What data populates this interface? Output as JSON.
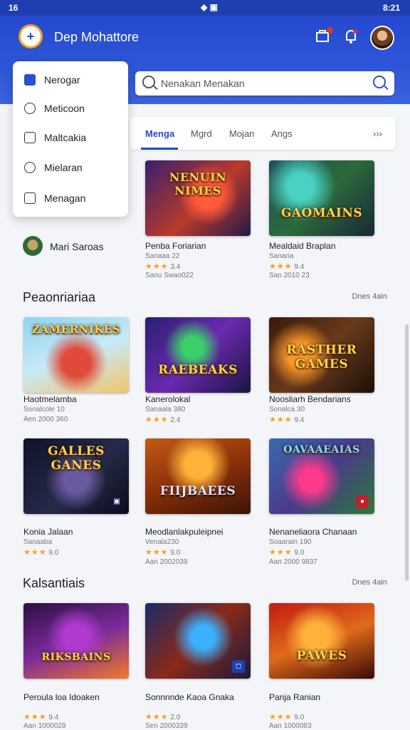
{
  "status_bar": {
    "left": "16",
    "right": "8:21"
  },
  "header": {
    "title": "Dep Mohattore",
    "search_placeholder": "Nenakan Menakan",
    "notification_count": ""
  },
  "menu": {
    "items": [
      {
        "label": "Nerogar",
        "icon": "square-filled-icon"
      },
      {
        "label": "Meticoon",
        "icon": "circle-icon"
      },
      {
        "label": "Maltcakia",
        "icon": "folder-icon"
      },
      {
        "label": "Mielaran",
        "icon": "user-icon"
      },
      {
        "label": "Menagan",
        "icon": "box-icon"
      }
    ]
  },
  "tabs": [
    "Menga",
    "Mgrd",
    "Mojan",
    "Angs",
    "›››"
  ],
  "side_user": {
    "name": "Mari Saroas"
  },
  "top_games": [
    {
      "title": "Penba Foriarian",
      "sub": "Sanaaa 22",
      "rating": "3.4",
      "meta": "Sanu Swao022",
      "art_text": "NENUIN NIMES"
    },
    {
      "title": "Mealdaid Braplan",
      "sub": "Sanaria",
      "rating": "9.4",
      "meta": "San 2010 23",
      "art_text": "GAOMAINS"
    }
  ],
  "sections": [
    {
      "title": "Peaonriariaa",
      "more": "Dnes 4ain",
      "games": [
        {
          "title": "Haotmelamba",
          "sub": "Sonalcole 10",
          "rating": "",
          "meta": "Aen 2000 360",
          "art_text": "ZAMERNIKES"
        },
        {
          "title": "Kanerolokal",
          "sub": "Sanaala 380",
          "rating": "2.4",
          "meta": "",
          "art_text": "RAEBEAKS"
        },
        {
          "title": "Noosliarh Bendarians",
          "sub": "Sonalca 30",
          "rating": "9.4",
          "meta": "",
          "art_text": "RASTHER GAMES"
        },
        {
          "title": "Konia Jalaan",
          "sub": "Sanaaba",
          "rating": "9.0",
          "meta": "",
          "art_text": "GALLES GANES"
        },
        {
          "title": "Meodlanlakpuleipnei",
          "sub": "Venala230",
          "rating": "9.0",
          "meta": "Aan 2002039",
          "art_text": "FIIJBAEES"
        },
        {
          "title": "Nenaneliaora Chanaan",
          "sub": "Soaarain 190",
          "rating": "9.0",
          "meta": "Aan 2000 9837",
          "art_text": "OAVAAEAIAS"
        }
      ]
    },
    {
      "title": "Kalsantiais",
      "more": "Dnes 4ain",
      "games": [
        {
          "title": "Peroula loa Idoaken",
          "sub": "",
          "rating": "9.4",
          "meta": "Aan 1000029",
          "art_text": "RIKSBAINS"
        },
        {
          "title": "Sonnnnde Kaoa Gnaka",
          "sub": "",
          "rating": "2.0",
          "meta": "Sen 2000339",
          "art_text": ""
        },
        {
          "title": "Panja Ranian",
          "sub": "",
          "rating": "9.0",
          "meta": "Aan 1000083",
          "art_text": "PAWES"
        }
      ]
    }
  ],
  "colors": {
    "brand": "#2548cf",
    "accent": "#f2a21c",
    "star": "#f2a21c"
  }
}
